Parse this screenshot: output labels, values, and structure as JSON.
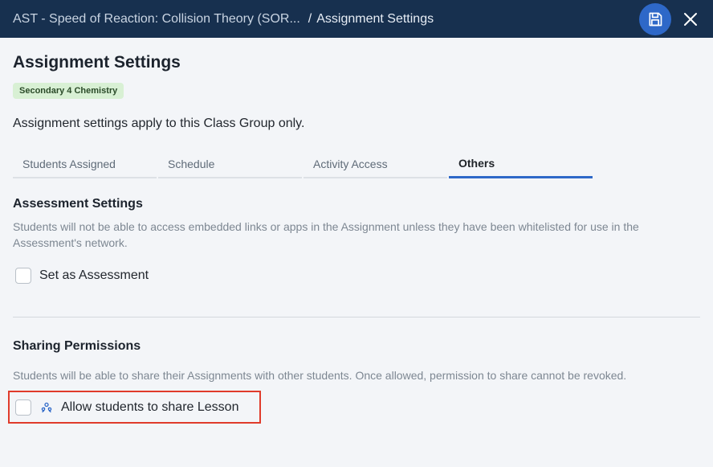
{
  "header": {
    "lesson_title": "AST - Speed of Reaction: Collision Theory (SOR...",
    "separator": "/",
    "current_page": "Assignment Settings",
    "save_icon": "floppy-disk-icon",
    "close_icon": "close-icon"
  },
  "main": {
    "title": "Assignment Settings",
    "class_badge": "Secondary 4 Chemistry",
    "scope_note": "Assignment settings apply to this Class Group only."
  },
  "tabs": [
    {
      "label": "Students Assigned",
      "active": false
    },
    {
      "label": "Schedule",
      "active": false
    },
    {
      "label": "Activity Access",
      "active": false
    },
    {
      "label": "Others",
      "active": true
    }
  ],
  "assessment": {
    "title": "Assessment Settings",
    "description": "Students will not be able to access embedded links or apps in the Assignment unless they have been whitelisted for use in the Assessment's network.",
    "checkbox_label": "Set as Assessment",
    "checked": false
  },
  "sharing": {
    "title": "Sharing Permissions",
    "description": "Students will be able to share their Assignments with other students. Once allowed, permission to share cannot be revoked.",
    "checkbox_label": "Allow students to share Lesson",
    "checked": false,
    "icon": "share-people-icon"
  },
  "colors": {
    "header_bg": "#17304f",
    "accent": "#2e68c8",
    "badge_bg": "#d8f0d4",
    "highlight_border": "#e03b2b"
  }
}
